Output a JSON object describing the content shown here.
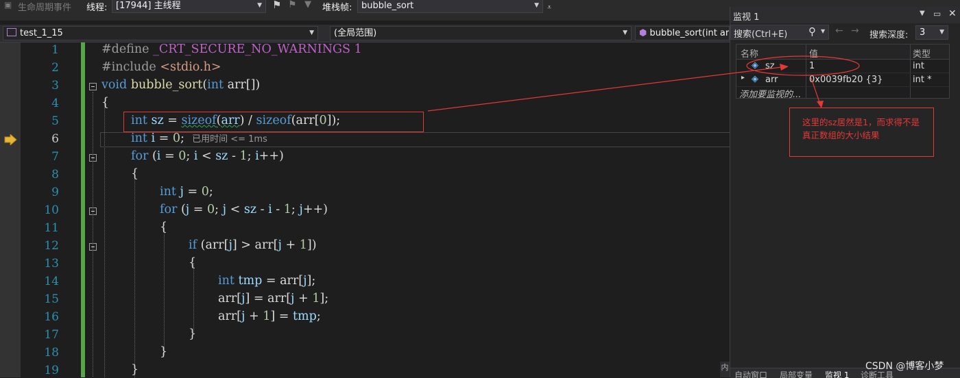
{
  "toolbar": {
    "lifecycle_label": "生命周期事件",
    "thread_label": "线程:",
    "thread_value": "[17944] 主线程",
    "stack_label": "堆栈帧:",
    "stack_value": "bubble_sort"
  },
  "nav": {
    "project": "test_1_15",
    "scope": "(全局范围)",
    "function": "bubble_sort(int ar"
  },
  "editor": {
    "current_line": 6,
    "line_numbers": [
      "1",
      "2",
      "3",
      "4",
      "5",
      "6",
      "7",
      "8",
      "9",
      "10",
      "11",
      "12",
      "13",
      "14",
      "15",
      "16",
      "17",
      "18",
      "19"
    ],
    "lines": {
      "l1": [
        "#define ",
        "_CRT_SECURE_NO_WARNINGS",
        " ",
        "1"
      ],
      "l2": [
        "#include ",
        "<stdio.h>"
      ],
      "l3": [
        "void",
        " ",
        "bubble_sort",
        "(",
        "int",
        " arr[])"
      ],
      "l4": "{",
      "l5": [
        "int",
        " ",
        "sz",
        " = ",
        "sizeof",
        "(",
        "arr",
        ") / ",
        "sizeof",
        "(arr[",
        "0",
        "]);"
      ],
      "l6": [
        "int",
        " ",
        "i",
        " = ",
        "0",
        ";"
      ],
      "l6_hint": "已用时间 <= 1ms",
      "l7": [
        "for",
        " (",
        "i",
        " = ",
        "0",
        "; ",
        "i",
        " < ",
        "sz",
        " - ",
        "1",
        "; ",
        "i",
        "++)"
      ],
      "l8": "{",
      "l9": [
        "int",
        " ",
        "j",
        " = ",
        "0",
        ";"
      ],
      "l10": [
        "for",
        " (",
        "j",
        " = ",
        "0",
        "; ",
        "j",
        " < ",
        "sz",
        " - ",
        "i",
        " - ",
        "1",
        "; ",
        "j",
        "++)"
      ],
      "l11": "{",
      "l12": [
        "if",
        " (arr[",
        "j",
        "] > arr[",
        "j",
        " + ",
        "1",
        "])"
      ],
      "l13": "{",
      "l14": [
        "int",
        " ",
        "tmp",
        " = arr[",
        "j",
        "];"
      ],
      "l15": [
        "arr[",
        "j",
        "] = arr[",
        "j",
        " + ",
        "1",
        "];"
      ],
      "l16": [
        "arr[",
        "j",
        " + ",
        "1",
        "] = ",
        "tmp",
        ";"
      ],
      "l17": "}",
      "l18": "}",
      "l19": "}"
    }
  },
  "watch": {
    "title": "监视 1",
    "search_placeholder": "搜索(Ctrl+E)",
    "depth_label": "搜索深度:",
    "depth_value": "3",
    "columns": {
      "name": "名称",
      "value": "值",
      "type": "类型"
    },
    "rows": [
      {
        "name": "sz",
        "value": "1",
        "type": "int"
      },
      {
        "name": "arr",
        "value": "0x0039fb20 {3}",
        "type": "int *"
      }
    ],
    "add_item": "添加要监视的..."
  },
  "annotation": {
    "text": "这里的sz居然是1，而求得不是真正数组的大小结果"
  },
  "bottom_tabs": [
    "自动窗口",
    "局部变量",
    "监视 1",
    "诊断工具"
  ],
  "side_tab": "内",
  "watermark": "CSDN @博客小梦",
  "colors": {
    "keyword": "#569cd6",
    "function": "#dcdcaa",
    "number": "#b5cea8",
    "variable": "#9cdcfe",
    "macro": "#bd63c5",
    "annotation_red": "#e53935",
    "change_bar": "#57a64a"
  }
}
